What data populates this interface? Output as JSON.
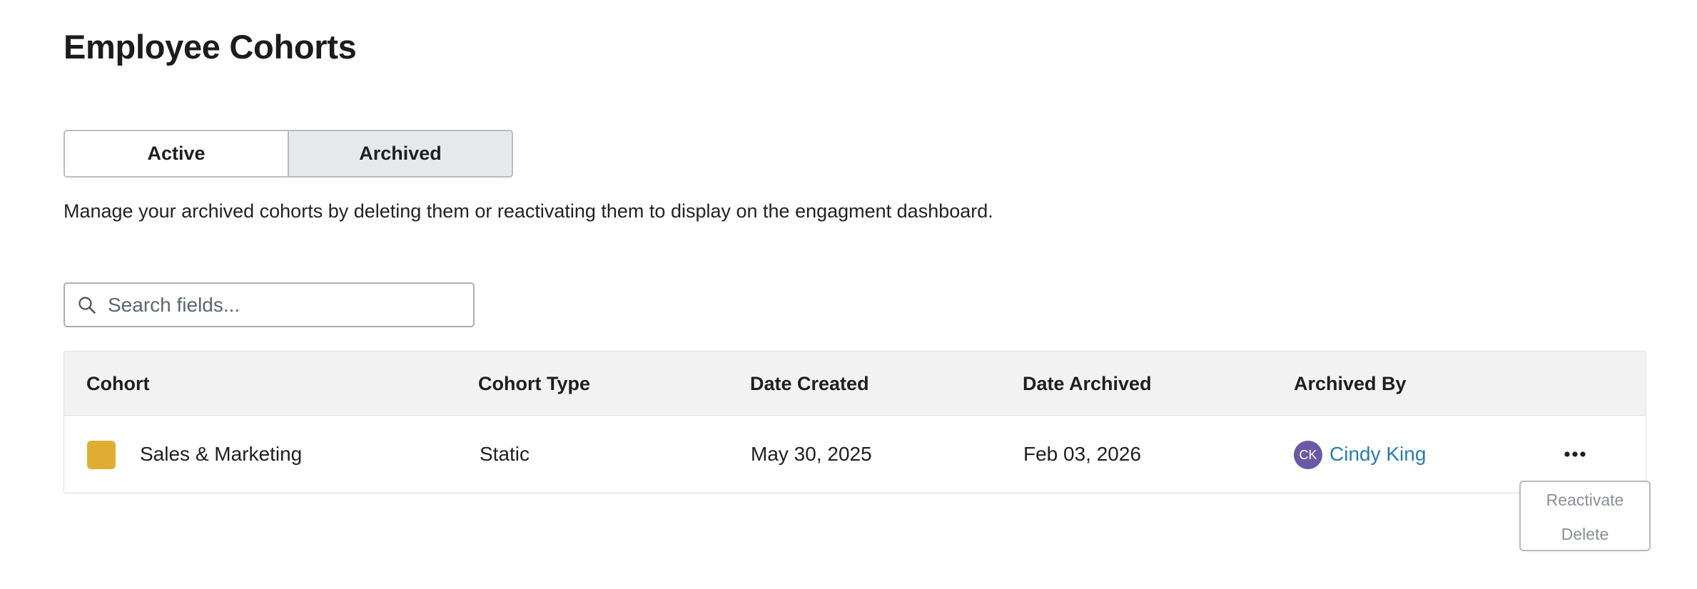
{
  "page": {
    "title": "Employee Cohorts"
  },
  "tabs": [
    {
      "label": "Active",
      "selected": false
    },
    {
      "label": "Archived",
      "selected": true
    }
  ],
  "description": "Manage your archived cohorts by deleting them or reactivating them to display on the engagment dashboard.",
  "search": {
    "placeholder": "Search fields...",
    "value": "",
    "icon": "search-icon"
  },
  "table": {
    "columns": [
      "Cohort",
      "Cohort Type",
      "Date Created",
      "Date Archived",
      "Archived By"
    ],
    "rows": [
      {
        "cohort": "Sales & Marketing",
        "swatch_color": "#e0ad33",
        "cohort_type": "Static",
        "date_created": "May 30, 2025",
        "date_archived": "Feb 03, 2026",
        "archived_by": {
          "initials": "CK",
          "name": "Cindy King",
          "avatar_color": "#6a5aa5"
        }
      }
    ]
  },
  "row_menu": {
    "trigger_icon": "more-horizontal-icon",
    "items": [
      "Reactivate",
      "Delete"
    ]
  },
  "colors": {
    "link": "#2b7bb0",
    "header_bg": "#f2f2f2",
    "selected_tab_bg": "#e6e8eb",
    "menu_text": "#8a9096"
  }
}
